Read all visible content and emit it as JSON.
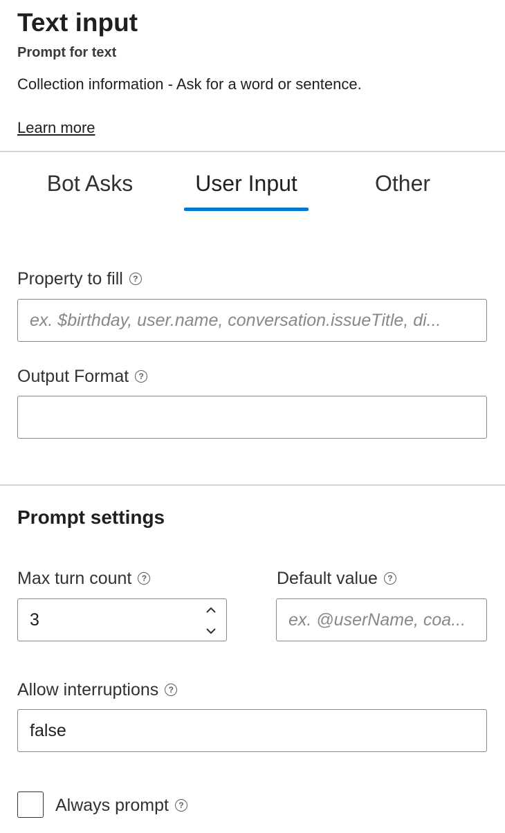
{
  "header": {
    "title": "Text input",
    "subtitle": "Prompt for text",
    "description": "Collection information - Ask for a word or sentence.",
    "learn_more": "Learn more"
  },
  "tabs": [
    {
      "label": "Bot Asks",
      "active": false
    },
    {
      "label": "User Input",
      "active": true
    },
    {
      "label": "Other",
      "active": false
    }
  ],
  "fields": {
    "property_label": "Property to fill",
    "property_placeholder": "ex. $birthday, user.name, conversation.issueTitle, di...",
    "property_value": "",
    "output_label": "Output Format",
    "output_value": ""
  },
  "prompt_settings": {
    "title": "Prompt settings",
    "max_turn_label": "Max turn count",
    "max_turn_value": "3",
    "default_label": "Default value",
    "default_placeholder": "ex. @userName, coa...",
    "allow_label": "Allow interruptions",
    "allow_value": "false",
    "always_label": "Always prompt",
    "always_checked": false
  },
  "icons": {
    "help": "help-circle-icon",
    "spin_up": "chevron-up-icon",
    "spin_down": "chevron-down-icon"
  },
  "colors": {
    "accent": "#0078d4",
    "text": "#201f1e",
    "border": "#8a8886",
    "divider": "#d6d6d6"
  }
}
